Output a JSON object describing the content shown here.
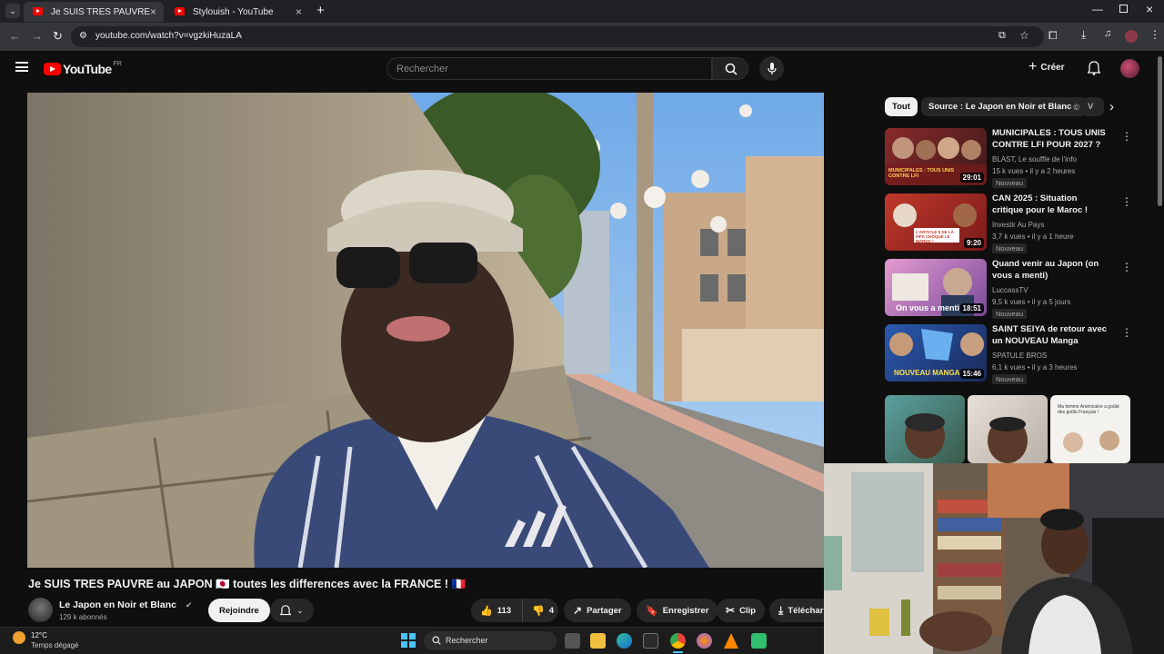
{
  "browser": {
    "tabs": [
      {
        "title": "Je SUIS TRES PAUVRE au JAPON"
      },
      {
        "title": "Stylouish - YouTube"
      }
    ],
    "url": "youtube.com/watch?v=vgzkiHuzaLA"
  },
  "header": {
    "logo": "YouTube",
    "region": "FR",
    "search_placeholder": "Rechercher",
    "create_label": "Créer"
  },
  "chips": [
    {
      "label": "Tout"
    },
    {
      "label": "Source : Le Japon en Noir et Blanc"
    },
    {
      "label": "V"
    }
  ],
  "recommendations": [
    {
      "title": "MUNICIPALES : TOUS UNIS CONTRE LFI POUR 2027 ?",
      "channel": "BLAST, Le souffle de l'info",
      "meta": "15 k vues • il y a 2 heures",
      "badge": "Nouveau",
      "duration": "29:01",
      "thumb_text": "MUNICIPALES : TOUS UNIS CONTRE LFI"
    },
    {
      "title": "CAN 2025 : Situation critique pour le Maroc !",
      "channel": "Investir Au Pays",
      "meta": "3,7 k vues • il y a 1 heure",
      "badge": "Nouveau",
      "duration": "9:20",
      "thumb_text": "L'ARTICLE 5 DE LA FIFA CHOQUE LE MAROC !"
    },
    {
      "title": "Quand venir au Japon (on vous a menti)",
      "channel": "LuccassTV",
      "meta": "9,5 k vues • il y a 5 jours",
      "badge": "Nouveau",
      "duration": "18:51",
      "thumb_text": "On vous a menti"
    },
    {
      "title": "SAINT SEIYA de retour avec un NOUVEAU Manga",
      "channel": "SPATULE BROS",
      "meta": "6,1 k vues • il y a 3 heures",
      "badge": "Nouveau",
      "duration": "15:46",
      "thumb_text": "NOUVEAU MANGA"
    }
  ],
  "shorts_caption": "Ma femme Américaine a goûté des goûts Français !",
  "video": {
    "title": "Je SUIS TRES PAUVRE au JAPON 🇯🇵 toutes les differences avec la FRANCE ! 🇫🇷",
    "channel": "Le Japon en Noir et Blanc",
    "subscribers": "129 k abonnés",
    "join_label": "Rejoindre",
    "likes": "113",
    "dislikes": "4",
    "share_label": "Partager",
    "save_label": "Enregistrer",
    "clip_label": "Clip",
    "download_label": "Téléchar"
  },
  "taskbar": {
    "weather_temp": "12°C",
    "weather_desc": "Temps dégagé",
    "search_label": "Rechercher"
  },
  "colors": {
    "brand": "#ff0000",
    "background": "#0f0f0f",
    "chip_active": "#f1f1f1"
  }
}
